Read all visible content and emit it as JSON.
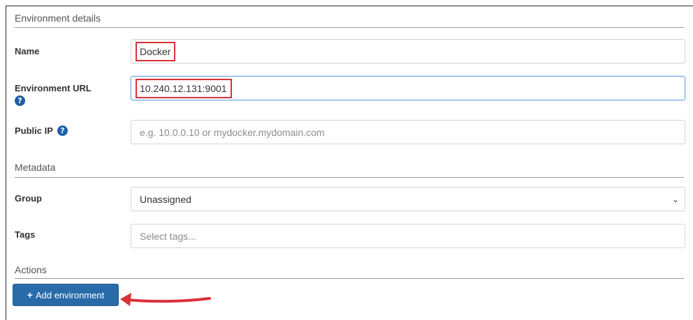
{
  "sections": {
    "environment_details": "Environment details",
    "metadata": "Metadata",
    "actions": "Actions"
  },
  "fields": {
    "name": {
      "label": "Name",
      "value": "Docker"
    },
    "environment_url": {
      "label": "Environment URL",
      "value": "10.240.12.131:9001"
    },
    "public_ip": {
      "label": "Public IP",
      "placeholder": "e.g. 10.0.0.10 or mydocker.mydomain.com"
    },
    "group": {
      "label": "Group",
      "value": "Unassigned"
    },
    "tags": {
      "label": "Tags",
      "placeholder": "Select tags..."
    }
  },
  "actions": {
    "add_environment_label": "Add environment"
  },
  "icons": {
    "help": "question-circle-icon",
    "plus": "plus-icon",
    "chevron": "chevron-down-icon",
    "annotation": "red-arrow"
  },
  "colors": {
    "primary_button": "#286ba8",
    "highlight": "#d9303b",
    "help_icon": "#1f5fa8"
  }
}
